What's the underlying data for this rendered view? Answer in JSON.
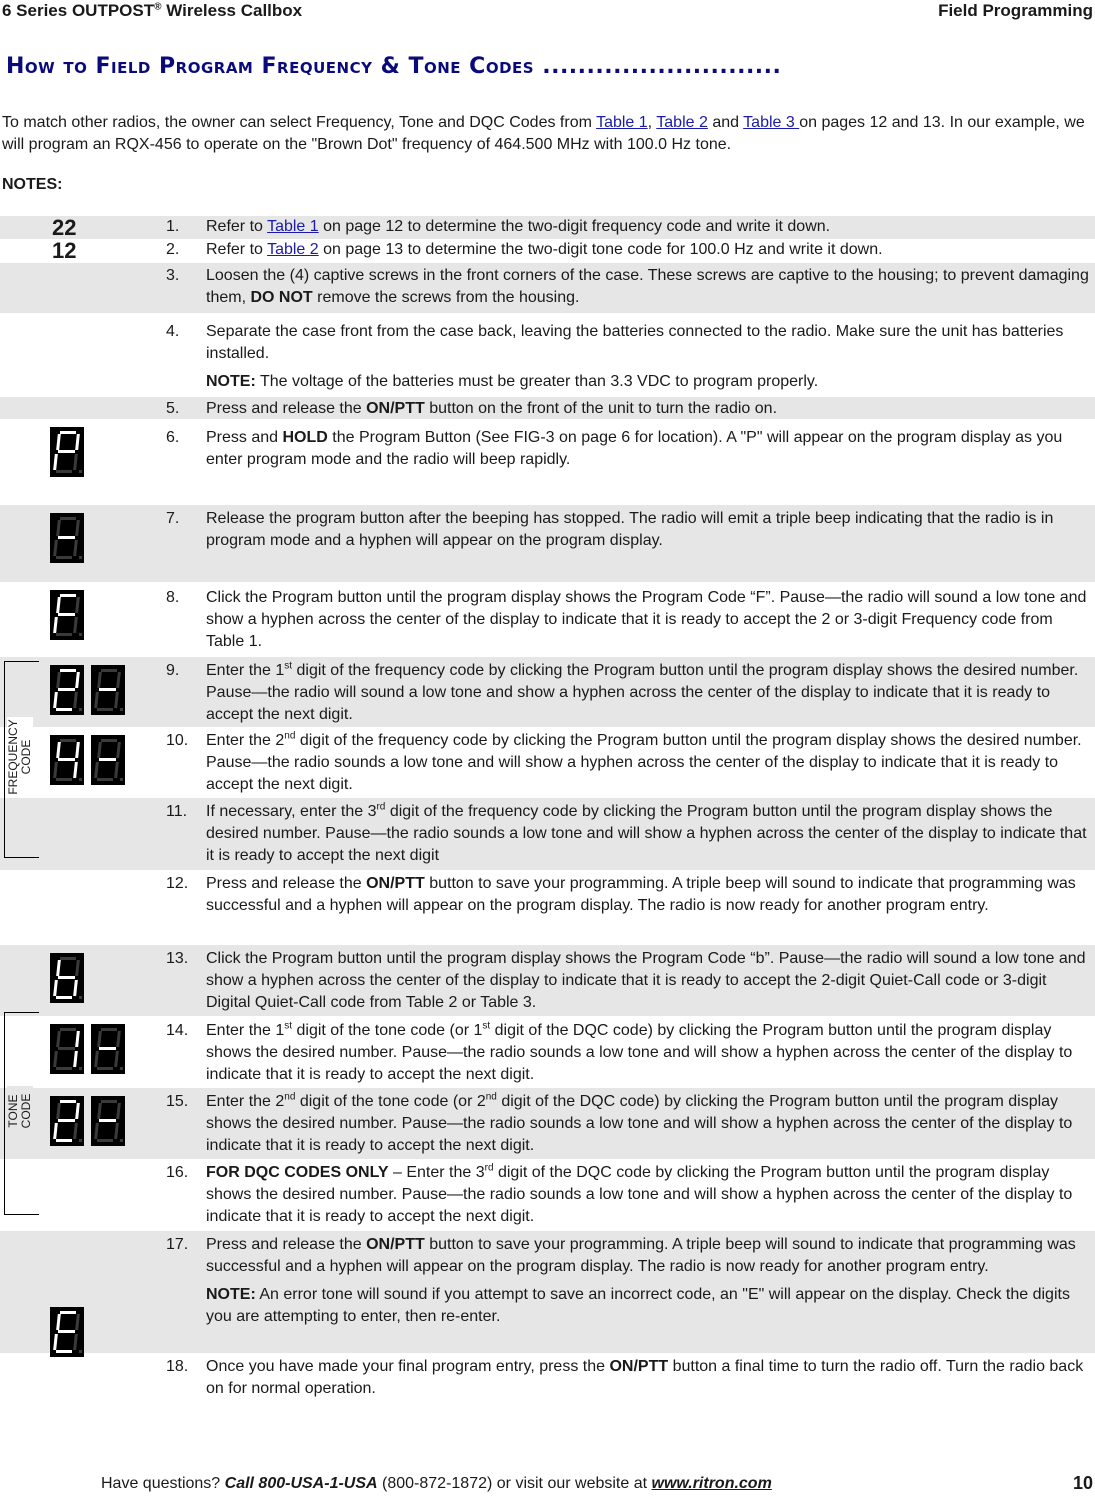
{
  "header": {
    "left_pre": "6 Series OUTPOST",
    "left_reg": "®",
    "left_post": " Wireless Callbox",
    "right": "Field Programming"
  },
  "title": "How to Field Program Frequency & Tone Codes ...........................",
  "intro": {
    "part1": "To match other radios, the owner can select Frequency, Tone and DQC Codes from ",
    "link1": "Table 1",
    "sep1": ", ",
    "link2": "Table 2",
    "sep2": " and ",
    "link3": "Table 3 ",
    "part2": "on pages 12 and 13. In our example, we will program an RQX-456 to operate on the \"Brown Dot\" frequency of 464.500 MHz with 100.0 Hz tone."
  },
  "notes_label": "NOTES:",
  "codes": {
    "frequency": "22",
    "tone": "12"
  },
  "steps": [
    {
      "n": "1.",
      "pre": "Refer to ",
      "link": "Table 1",
      "post": " on page 12 to determine the two-digit frequency code and write it down."
    },
    {
      "n": "2.",
      "pre": "Refer to ",
      "link": "Table 2",
      "post": " on page 13 to determine the two-digit tone code for 100.0 Hz and write it down."
    },
    {
      "n": "3.",
      "pre": "Loosen the (4) captive screws in the front corners of the case. These screws are captive to the housing; to prevent damaging them, ",
      "bold": "DO NOT",
      "post": " remove the screws from the housing."
    },
    {
      "n": "4.",
      "text": "Separate the case front from the case back, leaving the batteries connected to the radio.  Make sure the unit has batteries installed.",
      "note_label": "NOTE:",
      "note": "  The voltage of the batteries must be greater than 3.3 VDC to program properly."
    },
    {
      "n": "5.",
      "pre": "Press and release the ",
      "bold": "ON/PTT",
      "post": " button on the front of the unit to turn the radio on."
    },
    {
      "n": "6.",
      "pre": "Press and ",
      "bold": "HOLD",
      "post": " the Program Button (See FIG-3 on page 6 for location). A \"P\" will appear on the program display as you enter program mode and the radio will beep rapidly."
    },
    {
      "n": "7.",
      "text": "Release the program button after the beeping has stopped. The radio will emit a triple beep indicating that the radio is in program mode and a hyphen will appear on the program display."
    },
    {
      "n": "8.",
      "text": "Click the Program button until the program display shows the Program Code “F”.  Pause—the radio will sound a low tone and show a hyphen across the center of the display to indicate that it is ready to accept the 2 or 3-digit Frequency code from Table 1."
    },
    {
      "n": "9.",
      "pre": "Enter the 1",
      "sup": "st",
      "post": " digit of the frequency code by clicking the Program button until the program display shows the desired number. Pause—the radio will sound a low tone and show a hyphen across the center of the display to indicate that it is ready to accept the next digit."
    },
    {
      "n": "10.",
      "pre": "Enter the 2",
      "sup": "nd",
      "post": " digit of the frequency code by clicking the Program button until the program display shows the desired number. Pause—the radio sounds a low tone and will show a hyphen across the center of the display to indicate that it is ready to accept the next digit."
    },
    {
      "n": "11.",
      "pre": "If necessary, enter the 3",
      "sup": "rd",
      "post": " digit of the frequency code by clicking the Program button until the program display shows the desired number. Pause—the radio sounds a low tone and will show a hyphen across the center of the display to indicate that it is ready to accept the next digit"
    },
    {
      "n": "12.",
      "pre": "Press and release the ",
      "bold": "ON/PTT",
      "post": " button to save your programming. A triple beep will sound to indicate that programming was successful and a hyphen will appear on the program display.  The radio is now ready for another program entry."
    },
    {
      "n": "13.",
      "text": "Click the Program button until the program display shows the Program Code “b”.  Pause—the radio will sound a low tone and show a hyphen across the center of the display to indicate that it is ready to accept the 2-digit Quiet-Call code or 3-digit Digital Quiet-Call code from Table 2 or Table 3."
    },
    {
      "n": "14.",
      "pre": "Enter the 1",
      "sup": "st",
      "mid": " digit of the tone code (or 1",
      "sup2": "st",
      "post": " digit of the DQC code) by clicking the Program button until the program display shows the desired number. Pause—the radio sounds a low tone and will show a hyphen across the center of the display to indicate that it is ready to accept the next digit."
    },
    {
      "n": "15.",
      "pre": "Enter the 2",
      "sup": "nd",
      "mid": " digit of the tone code (or 2",
      "sup2": "nd",
      "post": " digit of the DQC code) by clicking the Program button until the program display shows the desired number. Pause—the radio sounds a low tone and will show a hyphen across the center of the display to indicate that it is ready to accept the next digit."
    },
    {
      "n": "16.",
      "bold": "FOR DQC CODES ONLY",
      "pre": " – Enter the 3",
      "sup": "rd",
      "post": " digit of the DQC code by clicking the Program button until the program display shows the desired number. Pause—the radio sounds a low tone and will show a hyphen across the center of the display to indicate that it is ready to accept the next digit."
    },
    {
      "n": "17.",
      "pre": "Press and release the ",
      "bold": "ON/PTT",
      "post": " button to save your programming. A triple beep will sound to indicate that programming was successful and a hyphen will appear on the program display.  The radio is now ready for another program entry.",
      "note_label": "NOTE:",
      "note": "  An error tone will sound if you attempt to save an incorrect code, an \"E\" will appear on the display. Check the digits you are attempting to enter, then re-enter."
    },
    {
      "n": "18.",
      "pre": "Once you have made your final program entry, press the ",
      "bold": "ON/PTT",
      "post": " button a final time to turn the radio off. Turn the radio back on for normal operation."
    }
  ],
  "displays": {
    "step6": [
      "P"
    ],
    "step7": [
      "-"
    ],
    "step8": [
      "F"
    ],
    "step9": [
      "2",
      "-"
    ],
    "step10": [
      "4",
      "-"
    ],
    "step13": [
      "b"
    ],
    "step14": [
      "1",
      "-"
    ],
    "step15": [
      "2",
      "-"
    ],
    "step17": [
      "E"
    ]
  },
  "brackets": {
    "frequency": "FREQUENCY\nCODE",
    "frequency_l1": "FREQUENCY",
    "frequency_l2": "CODE",
    "tone_l1": "TONE",
    "tone_l2": "CODE"
  },
  "footer": {
    "pre": "Have questions?  ",
    "call": "Call 800-USA-1-USA",
    "mid": " (800-872-1872) or visit our website at ",
    "web": "www.ritron.com",
    "page": "10"
  },
  "colors": {
    "title": "#0a0a7a",
    "link": "#1b1ba6",
    "row_shade": "#e6e6e6"
  }
}
